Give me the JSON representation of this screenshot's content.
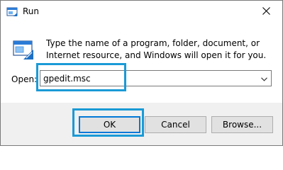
{
  "window": {
    "title": "Run",
    "icons": {
      "app": "run-app-icon",
      "close": "close-icon",
      "prompt": "run-prompt-icon",
      "dropdown": "chevron-down-icon"
    }
  },
  "dialog": {
    "instruction": "Type the name of a program, folder, document, or Internet resource, and Windows will open it for you.",
    "open_label": "Open:",
    "open_value": "gpedit.msc"
  },
  "buttons": {
    "ok": "OK",
    "cancel": "Cancel",
    "browse": "Browse..."
  },
  "colors": {
    "highlight": "#1a9ad6",
    "default_button_border": "#0078d7",
    "footer_bg": "#f0f0f0"
  }
}
